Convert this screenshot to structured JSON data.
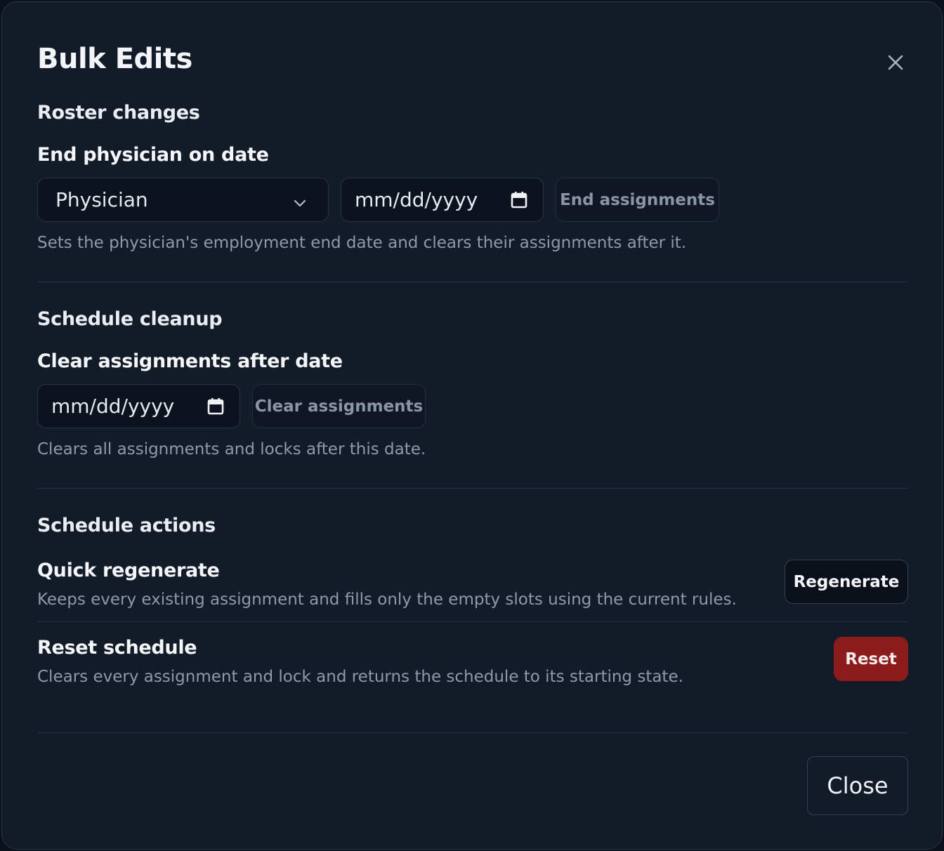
{
  "dialog": {
    "title": "Bulk Edits"
  },
  "roster": {
    "section_title": "Roster changes",
    "field_title": "End physician on date",
    "physician_select": "Physician",
    "date_placeholder": "mm/dd/yyyy",
    "end_button": "End assignments",
    "helper": "Sets the physician's employment end date and clears their assignments after it."
  },
  "cleanup": {
    "section_title": "Schedule cleanup",
    "field_title": "Clear assignments after date",
    "date_placeholder": "mm/dd/yyyy",
    "clear_button": "Clear assignments",
    "helper": "Clears all assignments and locks after this date."
  },
  "actions": {
    "section_title": "Schedule actions",
    "regenerate": {
      "title": "Quick regenerate",
      "helper": "Keeps every existing assignment and fills only the empty slots using the current rules.",
      "button": "Regenerate"
    },
    "reset": {
      "title": "Reset schedule",
      "helper": "Clears every assignment and lock and returns the schedule to its starting state.",
      "button": "Reset"
    }
  },
  "footer": {
    "close_button": "Close"
  },
  "colors": {
    "background": "#121c29",
    "danger": "#8c1b1b",
    "muted_text": "#8e9aaa"
  }
}
